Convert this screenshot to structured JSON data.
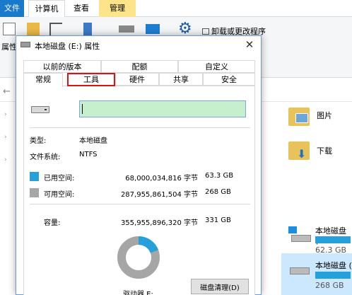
{
  "explorer": {
    "ribbon_tabs": {
      "file": "文件",
      "computer": "计算机",
      "view": "查看",
      "manage": "管理"
    },
    "ribbon": {
      "properties_label": "属性",
      "uninstall_label": "卸载或更改程序"
    },
    "items": {
      "pictures": "图片",
      "downloads": "下载",
      "c_drive_label": "本地磁盘 (C",
      "c_drive_free": "62.3 GB",
      "d_drive_label": "本地磁盘 (",
      "d_drive_free": "268 GB"
    },
    "colors": {
      "file_tab": "#1979ca",
      "manage_tab": "#fde38a",
      "capacity_bar": "#26a0da"
    }
  },
  "dialog": {
    "title": "本地磁盘 (E:) 属性",
    "tabs_top": [
      "以前的版本",
      "配额",
      "自定义"
    ],
    "tabs_bottom": [
      "常规",
      "工具",
      "硬件",
      "共享",
      "安全"
    ],
    "active_tab": "常规",
    "highlighted_tab": "工具",
    "volume_name": "",
    "type_label": "类型:",
    "type_value": "本地磁盘",
    "fs_label": "文件系统:",
    "fs_value": "NTFS",
    "used_label": "已用空间:",
    "used_bytes": "68,000,034,816 字节",
    "used_gb": "63.3 GB",
    "free_label": "可用空间:",
    "free_bytes": "287,955,861,504 字节",
    "free_gb": "268 GB",
    "capacity_label": "容量:",
    "capacity_bytes": "355,955,896,320 字节",
    "capacity_gb": "331 GB",
    "drive_letter_label": "驱动器 E:",
    "cleanup_button": "磁盘清理(D)",
    "used_fraction": 0.191,
    "colors": {
      "used": "#26a0da",
      "free": "#a6a6a6",
      "highlight": "#d8141b",
      "name_field": "#c6efce"
    }
  }
}
